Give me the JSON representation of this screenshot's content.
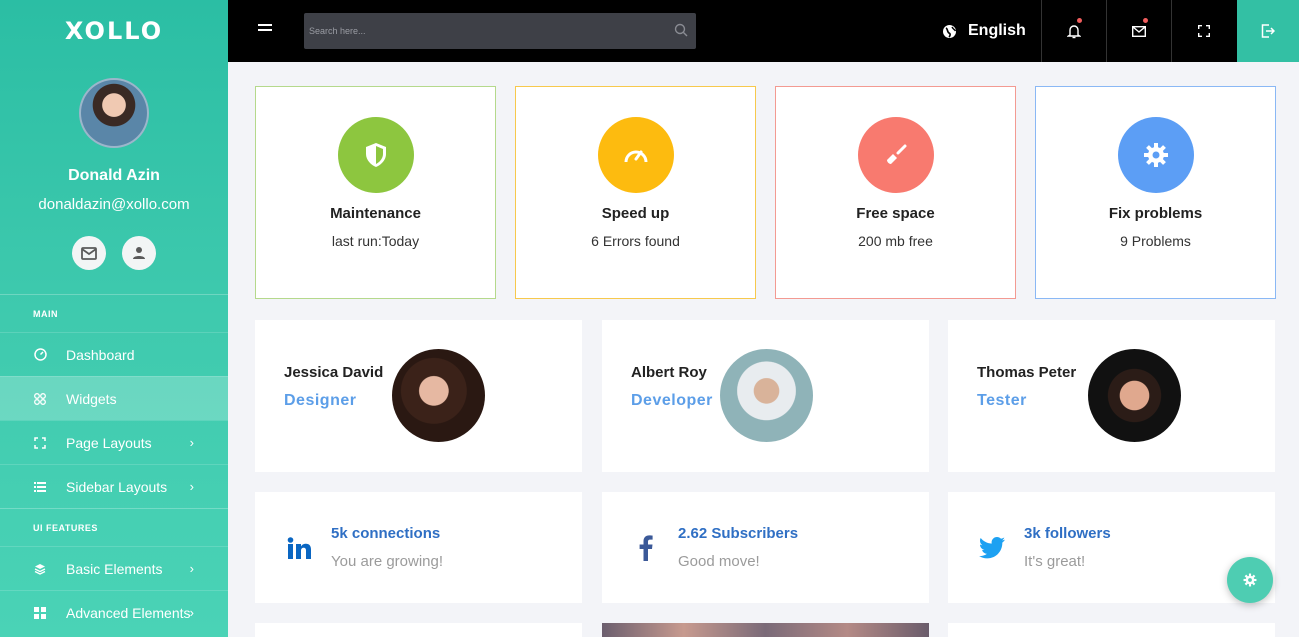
{
  "sidebar": {
    "logo": "XOLLO",
    "user": {
      "name": "Donald Azin",
      "email": "donaldazin@xollo.com"
    },
    "sections": [
      {
        "label": "MAIN"
      },
      {
        "label": "UI FEATURES"
      }
    ],
    "items": [
      {
        "label": "Dashboard",
        "icon": "dashboard-icon",
        "active": false
      },
      {
        "label": "Widgets",
        "icon": "widgets-icon",
        "active": true
      },
      {
        "label": "Page Layouts",
        "icon": "expand-icon",
        "active": false
      },
      {
        "label": "Sidebar Layouts",
        "icon": "list-icon",
        "active": false
      },
      {
        "label": "Basic Elements",
        "icon": "layers-icon",
        "active": false
      },
      {
        "label": "Advanced Elements",
        "icon": "grid-icon",
        "active": false
      }
    ]
  },
  "topbar": {
    "search_placeholder": "Search here...",
    "language": "English"
  },
  "stats": [
    {
      "title": "Maintenance",
      "subtitle": "last run:Today",
      "color": "#8dc63f",
      "border": "#b5d98c",
      "icon": "shield-icon"
    },
    {
      "title": "Speed up",
      "subtitle": "6 Errors found",
      "color": "#fdbb0f",
      "border": "#f7c94d",
      "icon": "speedometer-icon"
    },
    {
      "title": "Free space",
      "subtitle": "200 mb free",
      "color": "#f87a6f",
      "border": "#f39a92",
      "icon": "broom-icon"
    },
    {
      "title": "Fix problems",
      "subtitle": "9 Problems",
      "color": "#5c9ef5",
      "border": "#8ab8f5",
      "icon": "gear-icon"
    }
  ],
  "people": [
    {
      "name": "Jessica David",
      "role": "Designer"
    },
    {
      "name": "Albert Roy",
      "role": "Developer"
    },
    {
      "name": "Thomas Peter",
      "role": "Tester"
    }
  ],
  "social": [
    {
      "title": "5k connections",
      "subtitle": "You are growing!",
      "icon": "linkedin-icon",
      "color": "#0a66c2"
    },
    {
      "title": "2.62 Subscribers",
      "subtitle": "Good move!",
      "icon": "facebook-icon",
      "color": "#3b5998"
    },
    {
      "title": "3k followers",
      "subtitle": "It's great!",
      "icon": "twitter-icon",
      "color": "#1da1f2"
    }
  ]
}
